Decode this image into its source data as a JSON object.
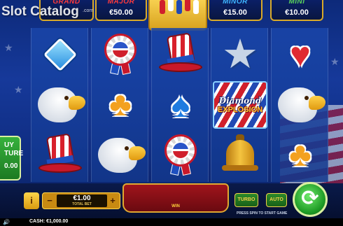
{
  "jackpots": {
    "grand": {
      "label": "GRAND",
      "value": ""
    },
    "major": {
      "label": "MAJOR",
      "value": "€50.00"
    },
    "minor": {
      "label": "MINOR",
      "value": "€15.00"
    },
    "mini": {
      "label": "MINI",
      "value": "€10.00"
    }
  },
  "watermark": {
    "text": "Slot Catalog",
    "sub": ".com"
  },
  "reels": [
    [
      "diamond",
      "eagle",
      "hat"
    ],
    [
      "rosette",
      "club",
      "eagle"
    ],
    [
      "hat",
      "spade",
      "rosette"
    ],
    [
      "star",
      "diamond-explosion",
      "bell"
    ],
    [
      "heart",
      "eagle",
      "club"
    ]
  ],
  "symbols": {
    "diamond_explosion_line1": "Diamond",
    "diamond_explosion_line2": "EXPLOSION"
  },
  "buy_feature": {
    "line1": "UY",
    "line2": "TURE",
    "price": "0.00"
  },
  "controls": {
    "info_label": "i",
    "minus_label": "−",
    "plus_label": "+",
    "bet_value": "€1.00",
    "bet_label": "TOTAL BET",
    "win_label": "WIN",
    "turbo_label": "TURBO",
    "auto_label": "AUTO",
    "press_text": "PRESS SPIN TO START GAME",
    "spin_icon": "spin-arrows-icon"
  },
  "footer": {
    "cash": "CASH: €1,000.00",
    "sound_icon": "speaker-icon"
  },
  "colors": {
    "accent_gold": "#d9a928",
    "spin_green": "#1d9a24",
    "win_red": "#a0141c"
  }
}
